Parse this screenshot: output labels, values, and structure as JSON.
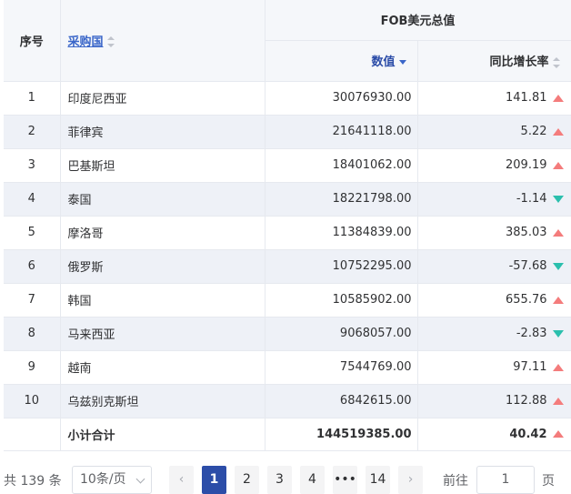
{
  "table": {
    "headers": {
      "index": "序号",
      "country": "采购国",
      "group": "FOB美元总值",
      "value": "数值",
      "growth": "同比增长率"
    },
    "rows": [
      {
        "index": "1",
        "country": "印度尼西亚",
        "value": "30076930.00",
        "growth": "141.81",
        "trend": "up"
      },
      {
        "index": "2",
        "country": "菲律宾",
        "value": "21641118.00",
        "growth": "5.22",
        "trend": "up"
      },
      {
        "index": "3",
        "country": "巴基斯坦",
        "value": "18401062.00",
        "growth": "209.19",
        "trend": "up"
      },
      {
        "index": "4",
        "country": "泰国",
        "value": "18221798.00",
        "growth": "-1.14",
        "trend": "down"
      },
      {
        "index": "5",
        "country": "摩洛哥",
        "value": "11384839.00",
        "growth": "385.03",
        "trend": "up"
      },
      {
        "index": "6",
        "country": "俄罗斯",
        "value": "10752295.00",
        "growth": "-57.68",
        "trend": "down"
      },
      {
        "index": "7",
        "country": "韩国",
        "value": "10585902.00",
        "growth": "655.76",
        "trend": "up"
      },
      {
        "index": "8",
        "country": "马来西亚",
        "value": "9068057.00",
        "growth": "-2.83",
        "trend": "down"
      },
      {
        "index": "9",
        "country": "越南",
        "value": "7544769.00",
        "growth": "97.11",
        "trend": "up"
      },
      {
        "index": "10",
        "country": "乌兹别克斯坦",
        "value": "6842615.00",
        "growth": "112.88",
        "trend": "up"
      }
    ],
    "total": {
      "label": "小计合计",
      "value": "144519385.00",
      "growth": "40.42",
      "trend": "up"
    }
  },
  "pagination": {
    "total_text": "共 139 条",
    "page_size": "10条/页",
    "pages": [
      "1",
      "2",
      "3",
      "4",
      "•••",
      "14"
    ],
    "current": "1",
    "goto_label": "前往",
    "goto_value": "1",
    "goto_unit": "页",
    "prev_icon": "chevron-left-icon",
    "next_icon": "chevron-right-icon"
  },
  "colors": {
    "up": "#f47c7c",
    "down": "#2bbfad",
    "accent": "#2c4da8",
    "stripe": "#eef1f7"
  }
}
